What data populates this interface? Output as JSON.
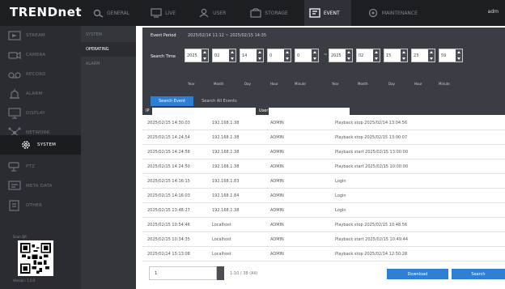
{
  "brand": {
    "logo": "TRENDnet"
  },
  "topnav": [
    {
      "label": "GENERAL",
      "icon": "settings-tool-icon",
      "active": false
    },
    {
      "label": "LIVE",
      "icon": "live-screen-icon",
      "active": false
    },
    {
      "label": "USER",
      "icon": "user-icon",
      "active": false
    },
    {
      "label": "STORAGE",
      "icon": "storage-icon",
      "active": false
    },
    {
      "label": "EVENT",
      "icon": "event-icon",
      "active": true
    },
    {
      "label": "MAINTENANCE",
      "icon": "maintenance-icon",
      "active": false
    }
  ],
  "user_label": "adm",
  "leftnav": [
    {
      "label": "STREAM",
      "icon": "stream-icon"
    },
    {
      "label": "CAMERA",
      "icon": "camera-icon"
    },
    {
      "label": "RECORD",
      "icon": "record-icon"
    },
    {
      "label": "ALARM",
      "icon": "alarm-icon"
    },
    {
      "label": "DISPLAY",
      "icon": "display-icon"
    },
    {
      "label": "NETWORK",
      "icon": "network-icon"
    },
    {
      "label": "SYSTEM",
      "icon": "system-icon",
      "active": true
    },
    {
      "label": "PTZ",
      "icon": "ptz-icon"
    },
    {
      "label": "META DATA",
      "icon": "metadata-icon"
    },
    {
      "label": "OTHER",
      "icon": "other-icon"
    }
  ],
  "qr_caption": "Version: 1.0.6",
  "qr_title": "Scan QR",
  "subnav": [
    {
      "label": "SYSTEM",
      "active": false
    },
    {
      "label": "OPERATING",
      "active": true
    },
    {
      "label": "ALARM",
      "active": false
    }
  ],
  "filter": {
    "event_period_label": "Event Period",
    "event_period_value": "2025/02/14 11:12 ~ 2025/02/15 14:35",
    "search_time_label": "Search Time",
    "start": {
      "year": "2025",
      "month": "02",
      "day": "14",
      "hour": "0",
      "minute": "0"
    },
    "end": {
      "year": "2025",
      "month": "02",
      "day": "15",
      "hour": "23",
      "minute": "59"
    },
    "units": {
      "year": "Year",
      "month": "Month",
      "day": "Day",
      "hour": "Hour",
      "minute": "Minute"
    },
    "search_event_tab": "Search Event",
    "search_all_tab": "Search All Events",
    "ip_label": "IP",
    "user_label": "User"
  },
  "table": {
    "rows": [
      [
        "2025/02/15 14:30:03",
        "192.168.1.38",
        "ADMIN",
        "Playback stop 2025/02/14 13:04:56"
      ],
      [
        "2025/02/15 14:24:54",
        "192.168.1.38",
        "ADMIN",
        "Playback stop 2025/02/15 13:00:07"
      ],
      [
        "2025/02/15 14:24:58",
        "192.168.1.38",
        "ADMIN",
        "Playback start 2025/02/15 13:00:00"
      ],
      [
        "2025/02/15 14:24:50",
        "192.168.1.38",
        "ADMIN",
        "Playback start 2025/02/15 10:00:00"
      ],
      [
        "2025/02/15 14:16:15",
        "192.168.1.83",
        "ADMIN",
        "Login"
      ],
      [
        "2025/02/15 14:16:03",
        "192.168.1.84",
        "ADMIN",
        "Login"
      ],
      [
        "2025/02/15 13:48:27",
        "192.168.1.38",
        "ADMIN",
        "Login"
      ],
      [
        "2025/02/15 10:54:46",
        "Localhost",
        "ADMIN",
        "Playback stop 2025/02/15 10:48:56"
      ],
      [
        "2025/02/15 10:34:35",
        "Localhost",
        "ADMIN",
        "Playback start 2025/02/15 10:49:44"
      ],
      [
        "2025/02/14 15:13:08",
        "Localhost",
        "ADMIN",
        "Playback stop 2025/02/14 12:50:28"
      ]
    ]
  },
  "footer": {
    "page_value": "1",
    "count_text": "1-10 / 38 (All)",
    "download_label": "Download",
    "search_label": "Search"
  },
  "colors": {
    "accent": "#2f7fd4",
    "topbar": "#1c1e22",
    "sidebar": "#2a2c31"
  }
}
